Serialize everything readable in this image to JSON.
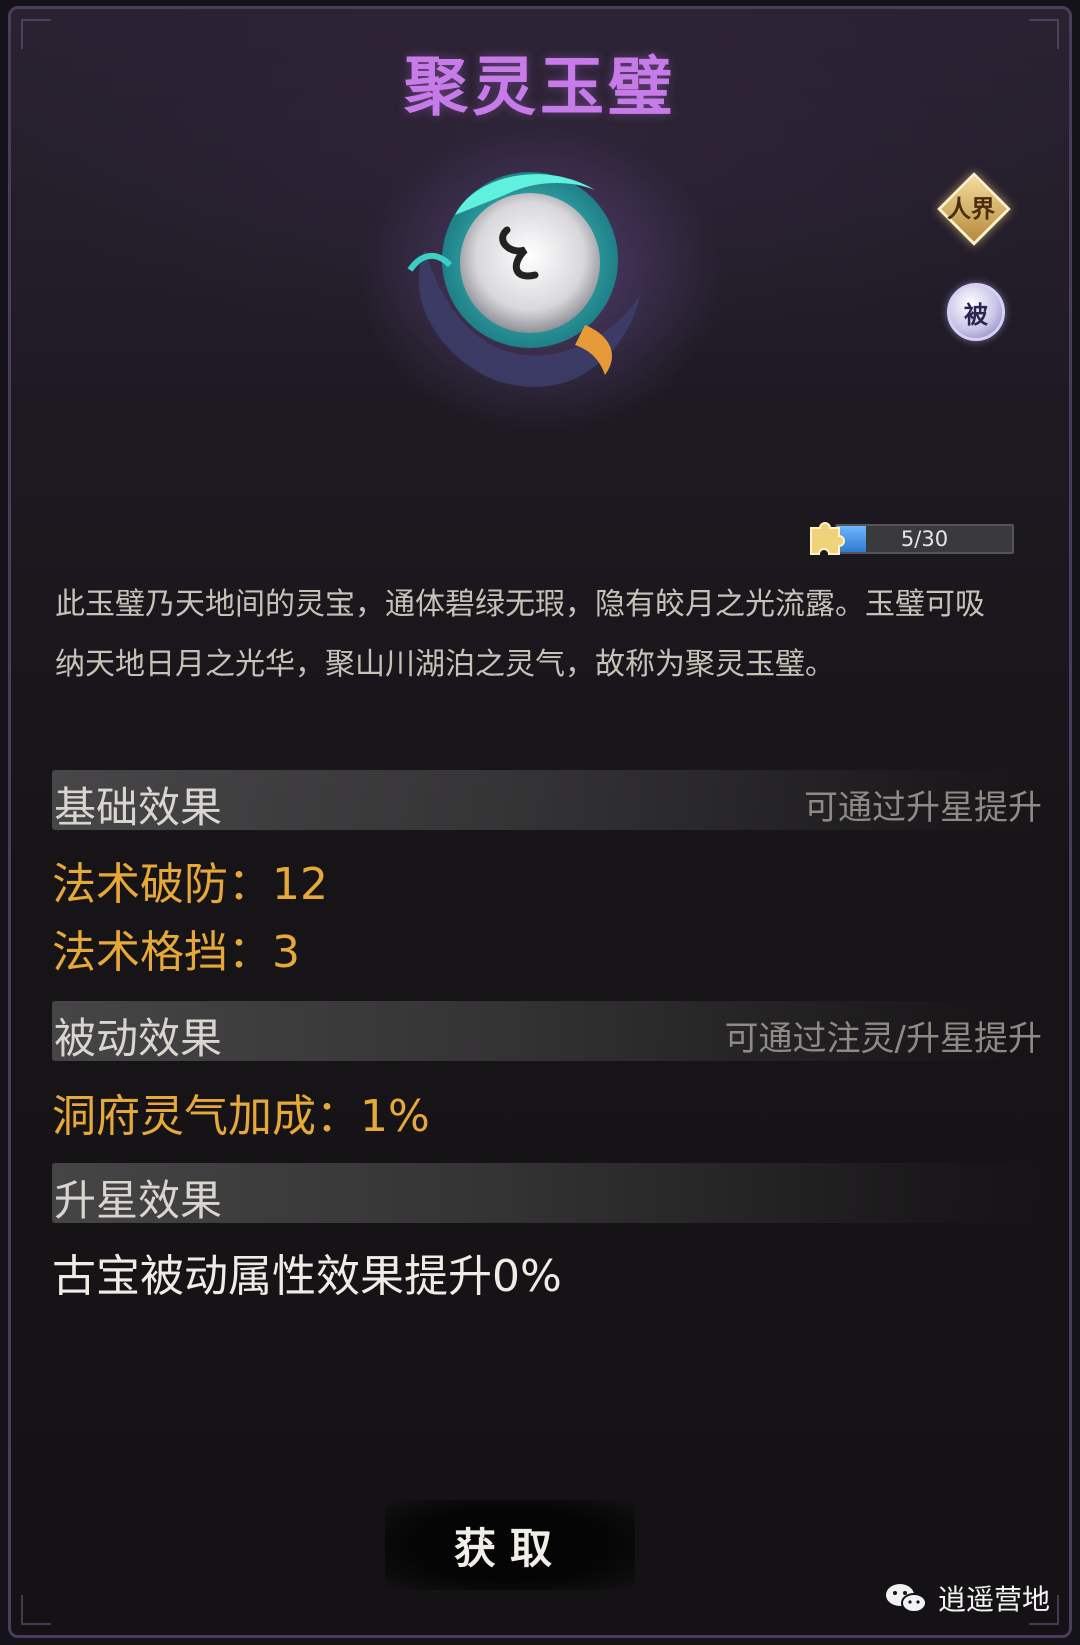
{
  "title": "聚灵玉璧",
  "badges": {
    "realm": "人界",
    "passive": "被"
  },
  "progress": {
    "label": "5/30",
    "fraction": 0.167
  },
  "description": "此玉璧乃天地间的灵宝，通体碧绿无瑕，隐有皎月之光流露。玉璧可吸纳天地日月之光华，聚山川湖泊之灵气，故称为聚灵玉璧。",
  "sections": {
    "base": {
      "heading": "基础效果",
      "hint": "可通过升星提升",
      "stats": [
        "法术破防：12",
        "法术格挡：3"
      ]
    },
    "passive": {
      "heading": "被动效果",
      "hint": "可通过注灵/升星提升",
      "stats": [
        "洞府灵气加成：1%"
      ]
    },
    "star": {
      "heading": "升星效果",
      "text": "古宝被动属性效果提升0%"
    }
  },
  "button": {
    "obtain": "获取"
  },
  "watermark": {
    "text": "逍遥营地"
  },
  "colors": {
    "title": "#c77be8",
    "stat": "#e7a83a",
    "progress_fill": "#2f7bd0"
  },
  "icons": [
    "jade-disc-icon",
    "puzzle-piece-icon",
    "wechat-icon"
  ]
}
